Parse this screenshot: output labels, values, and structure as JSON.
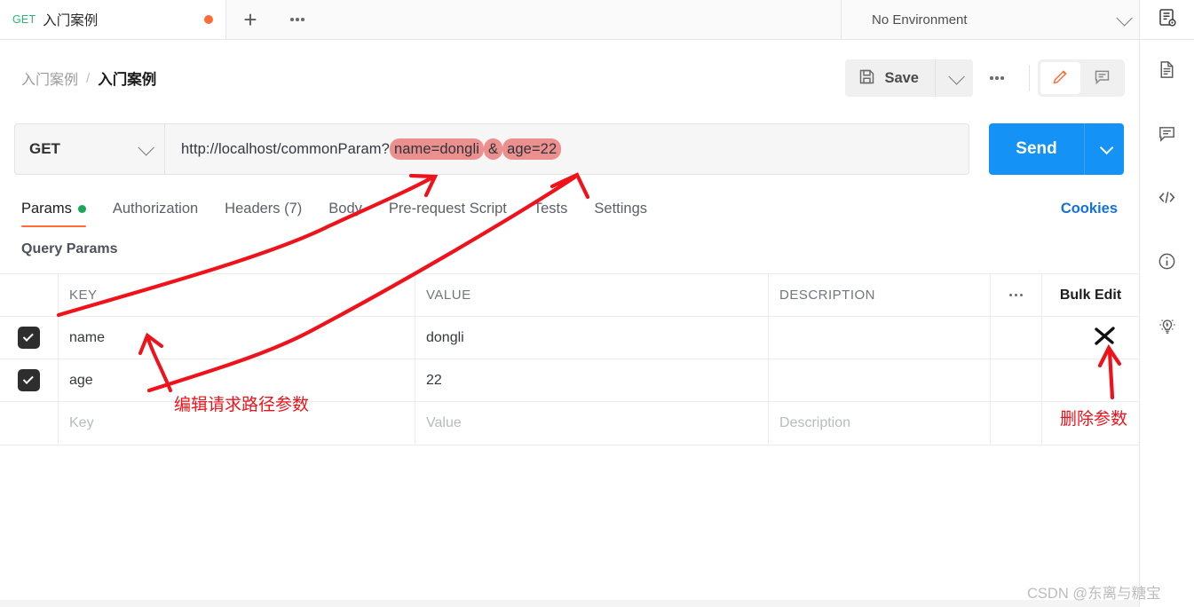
{
  "tab_bar": {
    "tabs": [
      {
        "method": "GET",
        "title": "入门案例",
        "unsaved": true,
        "unsaved_icon": "unsaved-dot"
      }
    ],
    "new_tab_icon": "plus-icon",
    "more_tabs_icon": "ellipsis-icon",
    "environment": {
      "selected": "No Environment",
      "chevron_icon": "chevron-down-icon",
      "quick_look_icon": "environment-quick-look-icon"
    }
  },
  "header": {
    "breadcrumb": {
      "parent": "入门案例",
      "separator": "/",
      "current": "入门案例"
    },
    "save_label": "Save",
    "save_icon": "floppy-disk-icon",
    "save_chevron_icon": "chevron-down-icon",
    "more_icon": "ellipsis-icon",
    "mode_buttons": [
      {
        "name": "edit-mode",
        "icon": "pencil-icon",
        "active": true,
        "color": "#ff6c37"
      },
      {
        "name": "comment-mode",
        "icon": "comment-icon",
        "active": false
      }
    ]
  },
  "request": {
    "method": "GET",
    "method_chevron_icon": "chevron-down-icon",
    "url": {
      "prefix": "http://localhost/commonParam?",
      "highlight_1": "name=dongli",
      "separator": "&",
      "highlight_2": "age=22",
      "full": "http://localhost/commonParam?name=dongli&age=22",
      "highlight_color": "#eb8f8f"
    },
    "send_label": "Send",
    "send_color": "#1592f5",
    "send_chevron_icon": "chevron-down-icon"
  },
  "request_tabs": {
    "items": [
      {
        "label": "Params",
        "active": true,
        "dot": true,
        "dot_color": "#18a957"
      },
      {
        "label": "Authorization",
        "active": false,
        "dot": false
      },
      {
        "label": "Headers (7)",
        "active": false,
        "dot": false
      },
      {
        "label": "Body",
        "active": false,
        "dot": false
      },
      {
        "label": "Pre-request Script",
        "active": false,
        "dot": false
      },
      {
        "label": "Tests",
        "active": false,
        "dot": false
      },
      {
        "label": "Settings",
        "active": false,
        "dot": false
      }
    ],
    "active_underline_color": "#ff6c37",
    "cookies_label": "Cookies",
    "cookies_color": "#1471d8"
  },
  "query_params": {
    "section_title": "Query Params",
    "columns": {
      "key": "KEY",
      "value": "VALUE",
      "description": "DESCRIPTION"
    },
    "options_icon": "ellipsis-icon",
    "bulk_edit_label": "Bulk Edit",
    "rows": [
      {
        "checked": true,
        "key": "name",
        "value": "dongli",
        "description": "",
        "delete_icon": "close-x-icon"
      },
      {
        "checked": true,
        "key": "age",
        "value": "22",
        "description": "",
        "delete_icon": ""
      }
    ],
    "empty_row": {
      "key_placeholder": "Key",
      "value_placeholder": "Value",
      "description_placeholder": "Description"
    }
  },
  "right_rail": {
    "top_icon": "environment-quick-look-icon",
    "items": [
      {
        "name": "documentation-icon",
        "label": "Documentation"
      },
      {
        "name": "comment-icon",
        "label": "Comments"
      },
      {
        "name": "code-snippet-icon",
        "label": "Code"
      },
      {
        "name": "info-icon",
        "label": "Info"
      },
      {
        "name": "lightbulb-icon",
        "label": "Tips"
      }
    ]
  },
  "annotations": {
    "color": "#f0121a",
    "edit_params_text": "编辑请求路径参数",
    "delete_param_text": "删除参数"
  },
  "watermark": "CSDN @东离与糖宝"
}
